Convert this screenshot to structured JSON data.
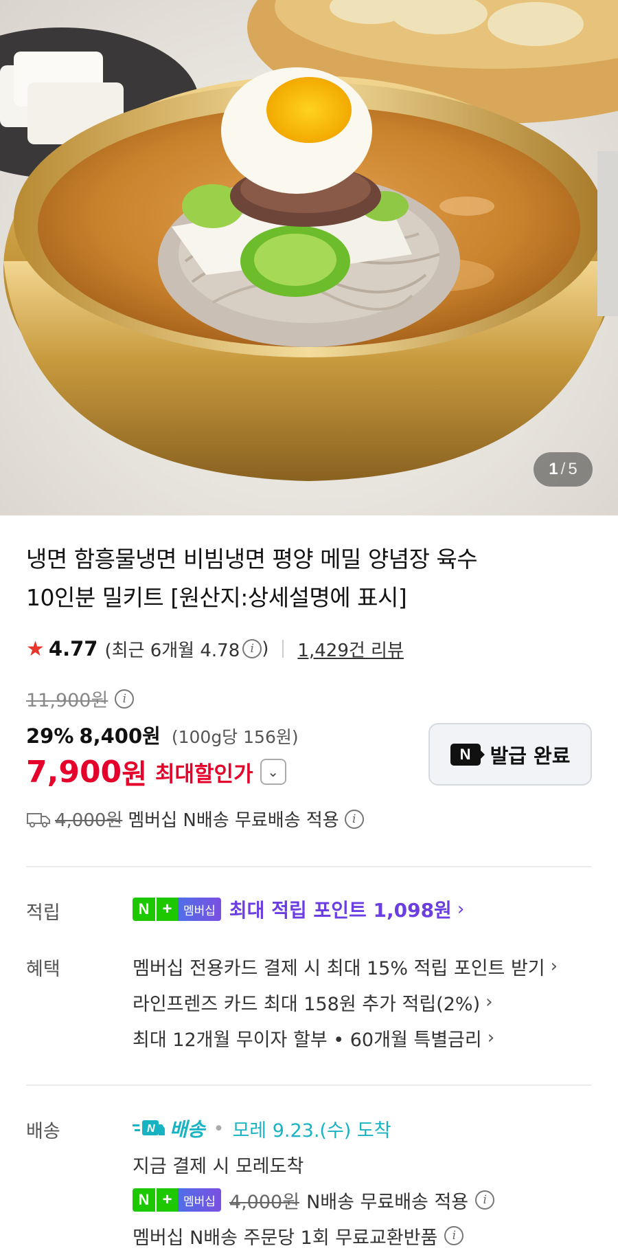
{
  "hero": {
    "page_current": "1",
    "page_separator": "/",
    "page_total": "5"
  },
  "product": {
    "title_line1": "냉면 함흥물냉면 비빔냉면 평양 메밀 양념장 육수",
    "title_line2": "10인분 밀키트 [원산지:상세설명에 표시]"
  },
  "rating": {
    "score": "4.77",
    "recent": "(최근 6개월 4.78",
    "recent_close": ")",
    "reviews": "1,429건 리뷰"
  },
  "price": {
    "original": "11,900원",
    "discount_pct": "29%",
    "discount_price": "8,400원",
    "unit_price": "(100g당 156원)",
    "final_value": "7,900",
    "final_won": "원",
    "final_label": "최대할인가"
  },
  "coupon": {
    "badge": "N",
    "label": "발급 완료"
  },
  "shipping_summary": {
    "orig_fee": "4,000원",
    "text": "멤버십 N배송 무료배송 적용"
  },
  "points": {
    "label": "적립",
    "badge_n": "N",
    "badge_plus": "+",
    "badge_member": "멤버십",
    "text": "최대 적립 포인트 1,098원"
  },
  "benefits": {
    "label": "혜택",
    "items": [
      "멤버십 전용카드 결제 시 최대 15% 적립 포인트 받기",
      "라인프렌즈 카드 최대 158원 추가 적립(2%)",
      "최대 12개월 무이자 할부 • 60개월 특별금리"
    ]
  },
  "delivery": {
    "label": "배송",
    "nship_label": "배송",
    "arrive": "모레 9.23.(수) 도착",
    "now_text": "지금 결제 시 모레도착",
    "orig_fee": "4,000원",
    "free_text": "N배송 무료배송 적용",
    "exchange_text": "멤버십 N배송 주문당 1회 무료교환반품"
  },
  "colors": {
    "accent_red": "#e4002b",
    "naver_green": "#1ec800",
    "point_purple": "#6a3ee0",
    "nship_teal": "#17b3c2"
  }
}
